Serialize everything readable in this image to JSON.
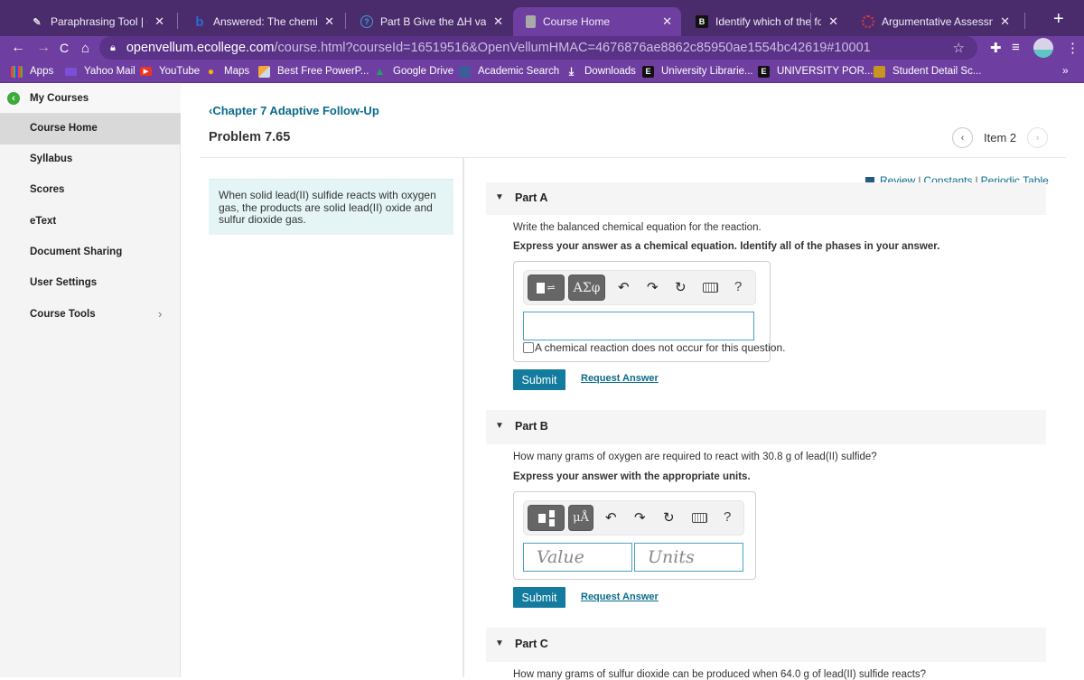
{
  "browser": {
    "tabs": [
      {
        "title": "Paraphrasing Tool | QuillBot",
        "icon": "quillbot-feather-icon",
        "active": false
      },
      {
        "title": "Answered: The chemical rea",
        "icon": "bartleby-b-icon",
        "active": false
      },
      {
        "title": "Part B Give the ΔH value for",
        "icon": "question-circle-icon",
        "active": false
      },
      {
        "title": "Course Home",
        "icon": "page-icon",
        "active": true
      },
      {
        "title": "Identify which of the followin",
        "icon": "brainly-b-icon",
        "active": false
      },
      {
        "title": "Argumentative Assessment",
        "icon": "canvas-icon",
        "active": false
      }
    ],
    "close_glyph": "✕",
    "new_tab_glyph": "+",
    "url_host": "openvellum.ecollege.com",
    "url_path": "/course.html?courseId=16519516&OpenVellumHMAC=4676876ae8862c85950ae1554bc42619#10001",
    "bookmarks": [
      {
        "label": "Apps",
        "icon": "apps-grid-icon"
      },
      {
        "label": "Yahoo Mail",
        "icon": "mail-icon"
      },
      {
        "label": "YouTube",
        "icon": "youtube-icon"
      },
      {
        "label": "Maps",
        "icon": "maps-pin-icon"
      },
      {
        "label": "Best Free PowerP...",
        "icon": "bookmark-slides-icon"
      },
      {
        "label": "Google Drive",
        "icon": "drive-icon"
      },
      {
        "label": "Academic Search",
        "icon": "academic-search-icon"
      },
      {
        "label": "Downloads",
        "icon": "download-icon"
      },
      {
        "label": "University Librarie...",
        "icon": "e-logo-icon"
      },
      {
        "label": "UNIVERSITY POR...",
        "icon": "e-logo-icon"
      },
      {
        "label": "Student Detail Sc...",
        "icon": "mascot-icon"
      }
    ],
    "bookmarks_overflow": "»"
  },
  "sidebar": {
    "my_courses": "My Courses",
    "items": [
      {
        "label": "Course Home",
        "active": true
      },
      {
        "label": "Syllabus"
      },
      {
        "label": "Scores"
      },
      {
        "label": "eText"
      },
      {
        "label": "Document Sharing"
      },
      {
        "label": "User Settings"
      },
      {
        "label": "Course Tools",
        "has_chevron": true
      }
    ]
  },
  "main": {
    "back_link": "Chapter 7 Adaptive Follow-Up",
    "problem_title": "Problem 7.65",
    "item_nav": {
      "label": "Item 2",
      "prev": "‹",
      "next": "›"
    },
    "intro": "When solid lead(II) sulfide reacts with oxygen gas, the products are solid lead(II) oxide and sulfur dioxide gas.",
    "references": {
      "review": "Review",
      "constants": "Constants",
      "periodic_table": "Periodic Table",
      "separator": "|"
    },
    "parts": [
      {
        "title": "Part A",
        "question": "Write the balanced chemical equation for the reaction.",
        "instruction": "Express your answer as a chemical equation. Identify all of the phases in your answer.",
        "template_buttons": [
          "reaction-template",
          "ΑΣφ"
        ],
        "tools": {
          "undo": "↶",
          "redo": "↷",
          "reset": "↻",
          "help": "?"
        },
        "answer_value": "",
        "no_reaction_label": "A chemical reaction does not occur for this question.",
        "no_reaction_checked": false,
        "submit": "Submit",
        "request_answer": "Request Answer"
      },
      {
        "title": "Part B",
        "question": "How many grams of oxygen are required to react with 30.8 g of lead(II) sulfide?",
        "instruction": "Express your answer with the appropriate units.",
        "template_buttons": [
          "units-template",
          "μÅ"
        ],
        "tools": {
          "undo": "↶",
          "redo": "↷",
          "reset": "↻",
          "help": "?"
        },
        "value_placeholder": "Value",
        "units_placeholder": "Units",
        "submit": "Submit",
        "request_answer": "Request Answer"
      },
      {
        "title": "Part C",
        "question": "How many grams of sulfur dioxide can be produced when 64.0 g of lead(II) sulfide reacts?"
      }
    ]
  },
  "colors": {
    "tabstrip": "#4a2c6c",
    "toolbar": "#6e3fa0",
    "link": "#0a6b8b",
    "submit": "#127b9e",
    "intro_bg": "#e5f5f6"
  }
}
